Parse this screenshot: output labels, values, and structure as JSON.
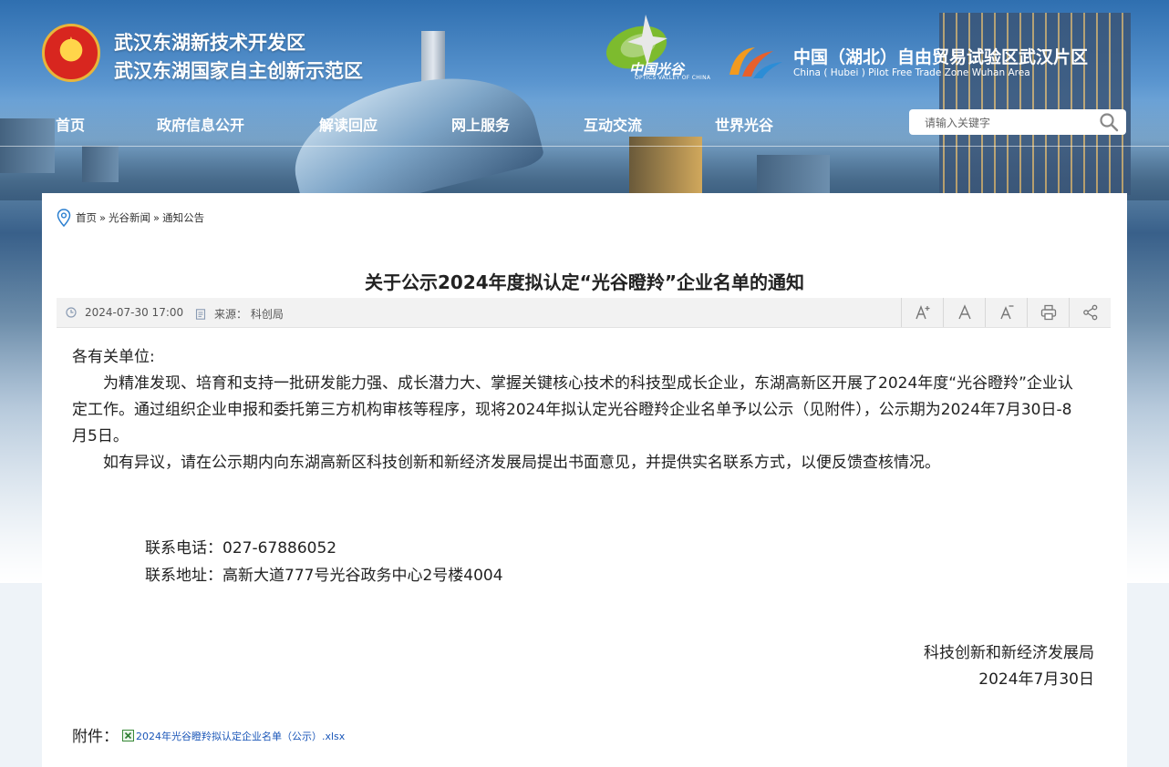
{
  "header": {
    "title_line1": "武汉东湖新技术开发区",
    "title_line2": "武汉东湖国家自主创新示范区",
    "ov_logo_text": "中国光谷",
    "ov_logo_sub": "OPTICS VALLEY OF CHINA",
    "ftz_cn": "中国（湖北）自由贸易试验区武汉片区",
    "ftz_en": "China ( Hubei ) Pilot Free Trade Zone Wuhan Area"
  },
  "nav": {
    "items": [
      "首页",
      "政府信息公开",
      "解读回应",
      "网上服务",
      "互动交流",
      "世界光谷"
    ]
  },
  "search": {
    "placeholder": "请输入关键字"
  },
  "breadcrumb": {
    "items": [
      "首页",
      "光谷新闻",
      "通知公告"
    ],
    "separator": "»"
  },
  "article": {
    "title": "关于公示2024年度拟认定“光谷瞪羚”企业名单的通知",
    "date": "2024-07-30 17:00",
    "source": "来源：  科创局",
    "salutation": "各有关单位:",
    "para1": "　　为精准发现、培育和支持一批研发能力强、成长潜力大、掌握关键核心技术的科技型成长企业，东湖高新区开展了2024年度“光谷瞪羚”企业认定工作。通过组织企业申报和委托第三方机构审核等程序，现将2024年拟认定光谷瞪羚企业名单予以公示（见附件），公示期为2024年7月30日-8月5日。",
    "para2": "　　如有异议，请在公示期内向东湖高新区科技创新和新经济发展局提出书面意见，并提供实名联系方式，以便反馈查核情况。",
    "contact_phone": "联系电话：027-67886052",
    "contact_address": "联系地址：高新大道777号光谷政务中心2号楼4004",
    "sign_org": "科技创新和新经济发展局",
    "sign_date": "2024年7月30日",
    "attachment_label": "附件：",
    "attachment_file": "2024年光谷瞪羚拟认定企业名单（公示）.xlsx"
  },
  "toolbar": {
    "icons": [
      "font-increase-icon",
      "font-reset-icon",
      "font-decrease-icon",
      "print-icon",
      "share-icon"
    ]
  },
  "colors": {
    "link": "#1a56b8",
    "meta_bg": "#f2f2f2",
    "header_blue": "#2f6fb0"
  }
}
